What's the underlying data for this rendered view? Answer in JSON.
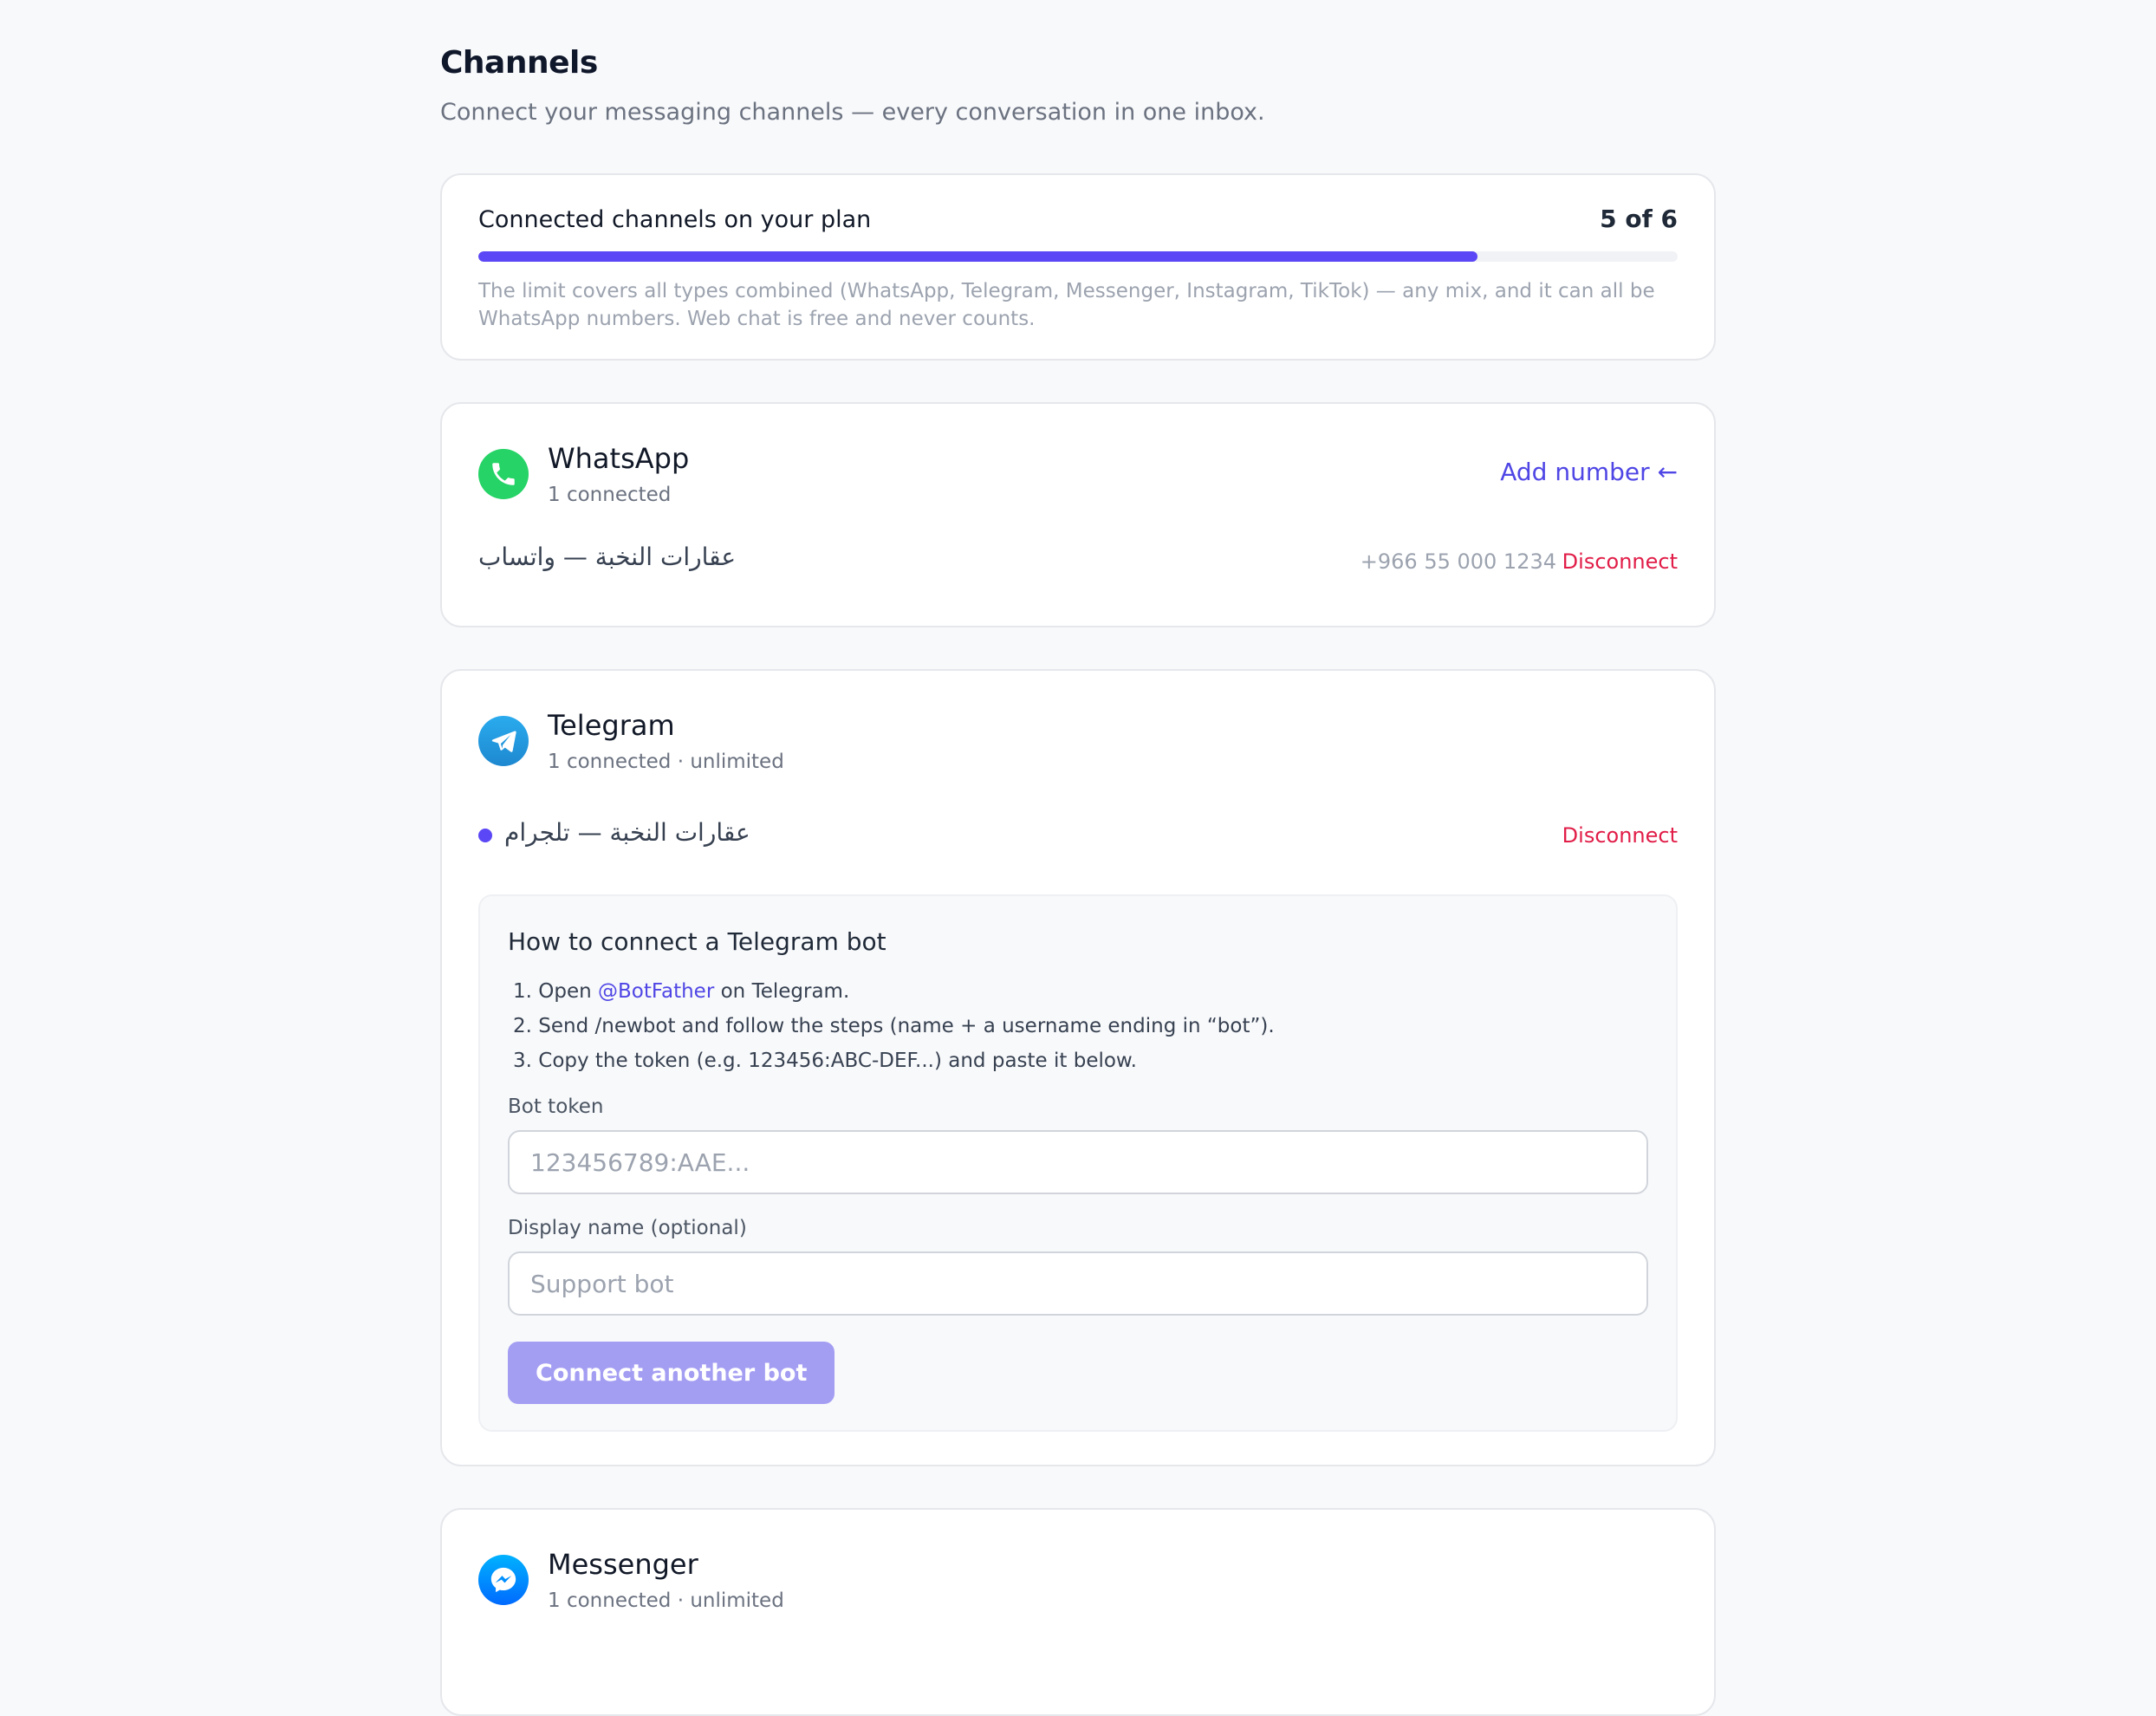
{
  "header": {
    "title": "Channels",
    "subtitle": "Connect your messaging channels — every conversation in one inbox."
  },
  "plan": {
    "label": "Connected channels on your plan",
    "count": "5 of 6",
    "used": 5,
    "limit": 6,
    "note": "The limit covers all types combined (WhatsApp, Telegram, Messenger, Instagram, TikTok) — any mix, and it can all be WhatsApp numbers. Web chat is free and never counts."
  },
  "whatsapp": {
    "name": "WhatsApp",
    "meta": "1 connected",
    "add_label": "Add number ←",
    "icon": "whatsapp-icon",
    "color": "#25d366",
    "connection": {
      "name": "عقارات النخبة — واتساب",
      "phone": "+966 55 000 1234",
      "disconnect_label": "Disconnect"
    }
  },
  "telegram": {
    "name": "Telegram",
    "meta": "1 connected · unlimited",
    "icon": "telegram-icon",
    "color": "#229ed9",
    "connection": {
      "name": "عقارات النخبة — تلجرام",
      "disconnect_label": "Disconnect"
    },
    "howto": {
      "title": "How to connect a Telegram bot",
      "step1_prefix": "1. Open ",
      "step1_link": "@BotFather",
      "step1_suffix": " on Telegram.",
      "step2": "2. Send /newbot and follow the steps (name + a username ending in “bot”).",
      "step3": "3. Copy the token (e.g. 123456:ABC-DEF...) and paste it below.",
      "token_label": "Bot token",
      "token_placeholder": "123456789:AAE...",
      "token_value": "",
      "display_label": "Display name (optional)",
      "display_placeholder": "Support bot",
      "display_value": "",
      "button_label": "Connect another bot"
    }
  },
  "messenger": {
    "name": "Messenger",
    "meta": "1 connected · unlimited",
    "icon": "messenger-icon",
    "color": "#1877f2"
  },
  "colors": {
    "accent": "#5b47f5",
    "link": "#4f46e5",
    "danger": "#e11d48",
    "button_disabled": "#a49ef3"
  }
}
